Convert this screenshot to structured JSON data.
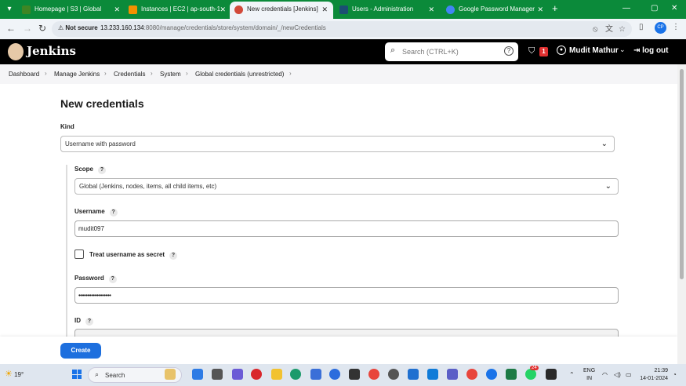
{
  "browser": {
    "tabs": [
      {
        "label": "Homepage | S3 | Global",
        "active": false,
        "favicon_color": "#3f8624"
      },
      {
        "label": "Instances | EC2 | ap-south-1",
        "active": false,
        "favicon_color": "#f29100"
      },
      {
        "label": "New credentials [Jenkins]",
        "active": true,
        "favicon_color": "#d24939"
      },
      {
        "label": "Users - Administration",
        "active": false,
        "favicon_color": "#1b4f72"
      },
      {
        "label": "Google Password Manager",
        "active": false,
        "favicon_color": "#4285f4"
      }
    ],
    "security_label": "Not secure",
    "url_host": "13.233.160.134",
    "url_path": ":8080/manage/credentials/store/system/domain/_/newCredentials",
    "profile_initials": "CP"
  },
  "header": {
    "app_name": "Jenkins",
    "search_placeholder": "Search (CTRL+K)",
    "search_help": "?",
    "security_badge_count": "1",
    "user_name": "Mudit Mathur",
    "logout_label": "log out"
  },
  "breadcrumb": [
    "Dashboard",
    "Manage Jenkins",
    "Credentials",
    "System",
    "Global credentials (unrestricted)"
  ],
  "form": {
    "title": "New credentials",
    "kind_label": "Kind",
    "kind_value": "Username with password",
    "scope_label": "Scope",
    "scope_value": "Global (Jenkins, nodes, items, all child items, etc)",
    "username_label": "Username",
    "username_value": "mudit097",
    "treat_secret_label": "Treat username as secret",
    "treat_secret_checked": false,
    "password_label": "Password",
    "password_value": "••••••••••••••••••",
    "id_label": "ID",
    "help_glyph": "?",
    "create_label": "Create"
  },
  "taskbar": {
    "weather_temp": "19°",
    "search_label": "Search",
    "language": "ENG",
    "region": "IN",
    "time": "21:39",
    "date": "14-01-2024",
    "notification_count": "24"
  }
}
